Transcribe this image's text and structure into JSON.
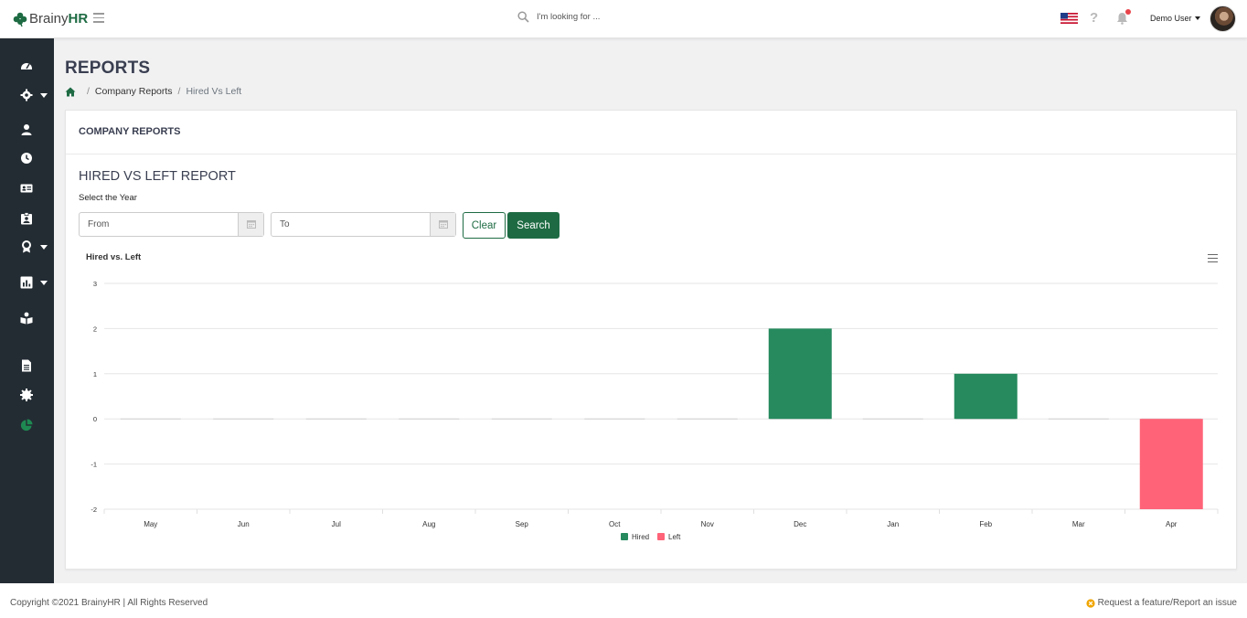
{
  "header": {
    "logo_brainy": "Brainy",
    "logo_hr": "HR",
    "search_placeholder": "I'm looking for ...",
    "help_glyph": "?",
    "user_name": "Demo User",
    "flag_icon": "us-flag-icon"
  },
  "sidebar": {
    "items": [
      {
        "icon": "dashboard-icon",
        "has_caret": false
      },
      {
        "icon": "settings-icon",
        "has_caret": true
      },
      {
        "icon": "employee-icon",
        "has_caret": false
      },
      {
        "icon": "clock-icon",
        "has_caret": false
      },
      {
        "icon": "id-card-icon",
        "has_caret": false
      },
      {
        "icon": "badge-icon",
        "has_caret": false
      },
      {
        "icon": "award-icon",
        "has_caret": true
      },
      {
        "icon": "chart-icon",
        "has_caret": true
      },
      {
        "icon": "training-icon",
        "has_caret": false
      },
      {
        "icon": "document-icon",
        "has_caret": false
      },
      {
        "icon": "gear-icon",
        "has_caret": false
      },
      {
        "icon": "pie-chart-icon",
        "has_caret": false,
        "active": true
      }
    ]
  },
  "page": {
    "title": "REPORTS",
    "breadcrumb": {
      "home_icon": "home-icon",
      "items": [
        "Company Reports",
        "Hired Vs Left"
      ],
      "sep": "/"
    }
  },
  "card": {
    "header": "COMPANY REPORTS",
    "report_title": "HIRED VS LEFT REPORT",
    "year_label": "Select the Year",
    "from_placeholder": "From",
    "to_placeholder": "To",
    "clear_label": "Clear",
    "search_label": "Search",
    "chart_title": "Hired vs. Left"
  },
  "colors": {
    "brand_green": "#1e6b43",
    "hired": "#268a5e",
    "left": "#ff6378",
    "sidebar": "#232c33"
  },
  "chart_data": {
    "type": "bar",
    "title": "Hired vs. Left",
    "categories": [
      "May",
      "Jun",
      "Jul",
      "Aug",
      "Sep",
      "Oct",
      "Nov",
      "Dec",
      "Jan",
      "Feb",
      "Mar",
      "Apr"
    ],
    "series": [
      {
        "name": "Hired",
        "color": "#268a5e",
        "values": [
          0,
          0,
          0,
          0,
          0,
          0,
          0,
          2,
          0,
          1,
          0,
          0
        ]
      },
      {
        "name": "Left",
        "color": "#ff6378",
        "values": [
          0,
          0,
          0,
          0,
          0,
          0,
          0,
          0,
          0,
          0,
          0,
          -2
        ]
      }
    ],
    "ylim": [
      -2,
      3
    ],
    "yticks": [
      "3",
      "2",
      "1",
      "0",
      "-1",
      "-2"
    ],
    "grid": true,
    "legend": "bottom-center"
  },
  "footer": {
    "copyright": "Copyright ©2021 BrainyHR | All Rights Reserved",
    "request": "Request a feature/Report an issue"
  }
}
